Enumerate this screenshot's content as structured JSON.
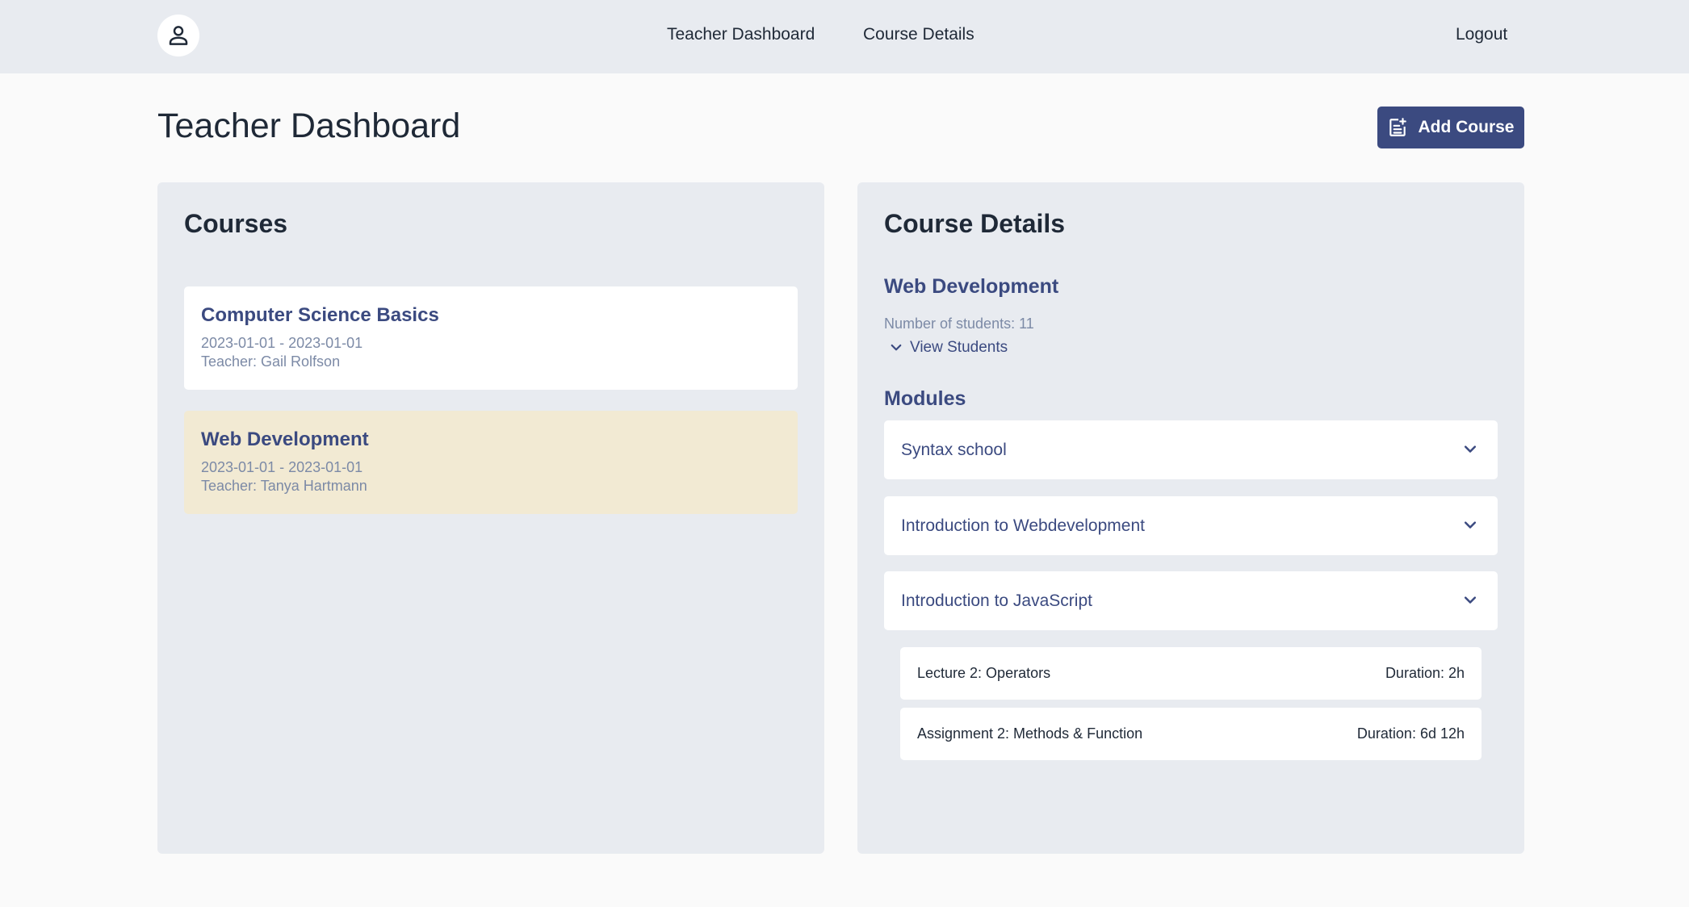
{
  "header": {
    "avatar_icon": "user-icon",
    "nav": {
      "dashboard_label": "Teacher Dashboard",
      "details_label": "Course Details"
    },
    "logout_label": "Logout"
  },
  "page": {
    "title": "Teacher Dashboard",
    "add_course_label": "Add Course",
    "add_course_icon": "note-add-icon"
  },
  "courses_panel": {
    "heading": "Courses",
    "courses": [
      {
        "title": "Computer Science Basics",
        "dates": "2023-01-01 - 2023-01-01",
        "teacher": "Teacher: Gail Rolfson",
        "selected": false
      },
      {
        "title": "Web Development",
        "dates": "2023-01-01 - 2023-01-01",
        "teacher": "Teacher: Tanya Hartmann",
        "selected": true
      }
    ]
  },
  "details_panel": {
    "heading": "Course Details",
    "course_title": "Web Development",
    "students_count": "Number of students: 11",
    "view_students_label": "View Students",
    "modules_heading": "Modules",
    "modules": [
      {
        "label": "Syntax school"
      },
      {
        "label": "Introduction to Webdevelopment"
      },
      {
        "label": "Introduction to JavaScript"
      }
    ],
    "lectures": [
      {
        "name": "Lecture 2: Operators",
        "duration": "Duration: 2h"
      },
      {
        "name": "Assignment 2: Methods & Function",
        "duration": "Duration: 6d 12h"
      }
    ]
  },
  "colors": {
    "accent": "#3b4a80",
    "panel_bg": "#e8ebf0",
    "selected_card": "#f2ead3",
    "muted_text": "#7c8aa6"
  }
}
